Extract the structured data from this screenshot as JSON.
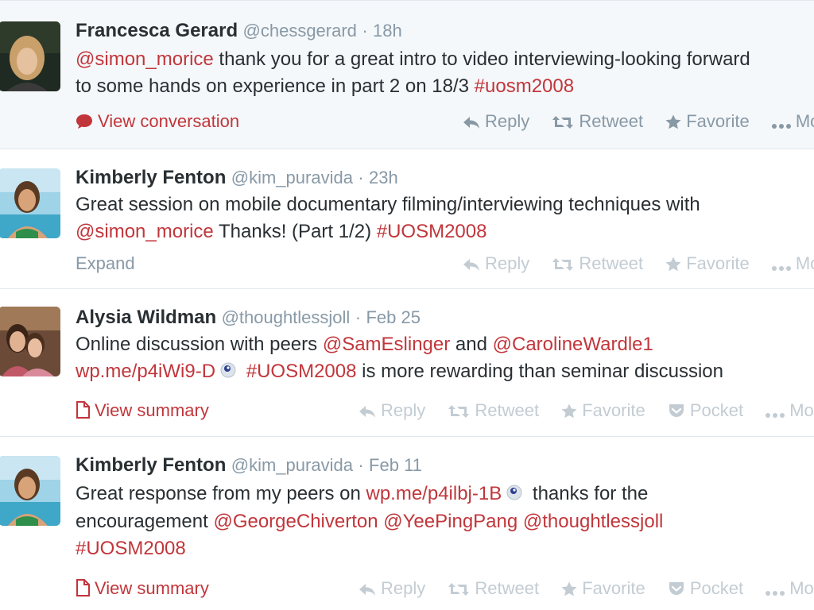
{
  "colors": {
    "accent": "#c1363b",
    "muted": "#8899a6",
    "divider": "#e1e8ed",
    "highlight_bg": "#f5f8fa"
  },
  "tweets": [
    {
      "fullname": "Francesca Gerard",
      "username": "@chessgerard",
      "separator": "·",
      "time": "18h",
      "line1": {
        "mention": "@simon_morice",
        "text": " thank you for a great intro to video interviewing-looking forward"
      },
      "line2": {
        "text": "to some hands on experience in part 2 on 18/3 ",
        "hashtag": "#uosm2008"
      },
      "left_action": "View conversation",
      "left_icon": "speech-bubble-icon",
      "actions": {
        "reply": "Reply",
        "retweet": "Retweet",
        "favorite": "Favorite",
        "more": "More"
      }
    },
    {
      "fullname": "Kimberly Fenton",
      "username": "@kim_puravida",
      "separator": "·",
      "time": "23h",
      "line1": {
        "text": "Great session on mobile documentary filming/interviewing techniques with"
      },
      "line2": {
        "mention": "@simon_morice",
        "text": " Thanks! (Part 1/2) ",
        "hashtag": "#UOSM2008"
      },
      "left_action": "Expand",
      "actions": {
        "reply": "Reply",
        "retweet": "Retweet",
        "favorite": "Favorite",
        "more": "More"
      }
    },
    {
      "fullname": "Alysia Wildman",
      "username": "@thoughtlessjoll",
      "separator": "·",
      "time": "Feb 25",
      "line1": {
        "text": "Online discussion with peers ",
        "mention1": "@SamEslinger",
        "text2": " and ",
        "mention2": "@CarolineWardle1"
      },
      "line2": {
        "link": "wp.me/p4iWi9-D",
        "link_icon": "wordpress-icon",
        "hashtag": "#UOSM2008",
        "text": " is more rewarding than seminar discussion"
      },
      "left_action": "View summary",
      "left_icon": "document-icon",
      "actions": {
        "reply": "Reply",
        "retweet": "Retweet",
        "favorite": "Favorite",
        "pocket": "Pocket",
        "more": "More"
      }
    },
    {
      "fullname": "Kimberly Fenton",
      "username": "@kim_puravida",
      "separator": "·",
      "time": "Feb 11",
      "line1": {
        "text": "Great response from my peers on ",
        "link": "wp.me/p4ilbj-1B",
        "link_icon": "wordpress-icon",
        "text2": " thanks for the"
      },
      "line2": {
        "text": "encouragement ",
        "mention1": "@GeorgeChiverton",
        "mention2": "@YeePingPang",
        "mention3": "@thoughtlessjoll"
      },
      "line3": {
        "hashtag": "#UOSM2008"
      },
      "left_action": "View summary",
      "left_icon": "document-icon",
      "actions": {
        "reply": "Reply",
        "retweet": "Retweet",
        "favorite": "Favorite",
        "pocket": "Pocket",
        "more": "More"
      }
    }
  ]
}
